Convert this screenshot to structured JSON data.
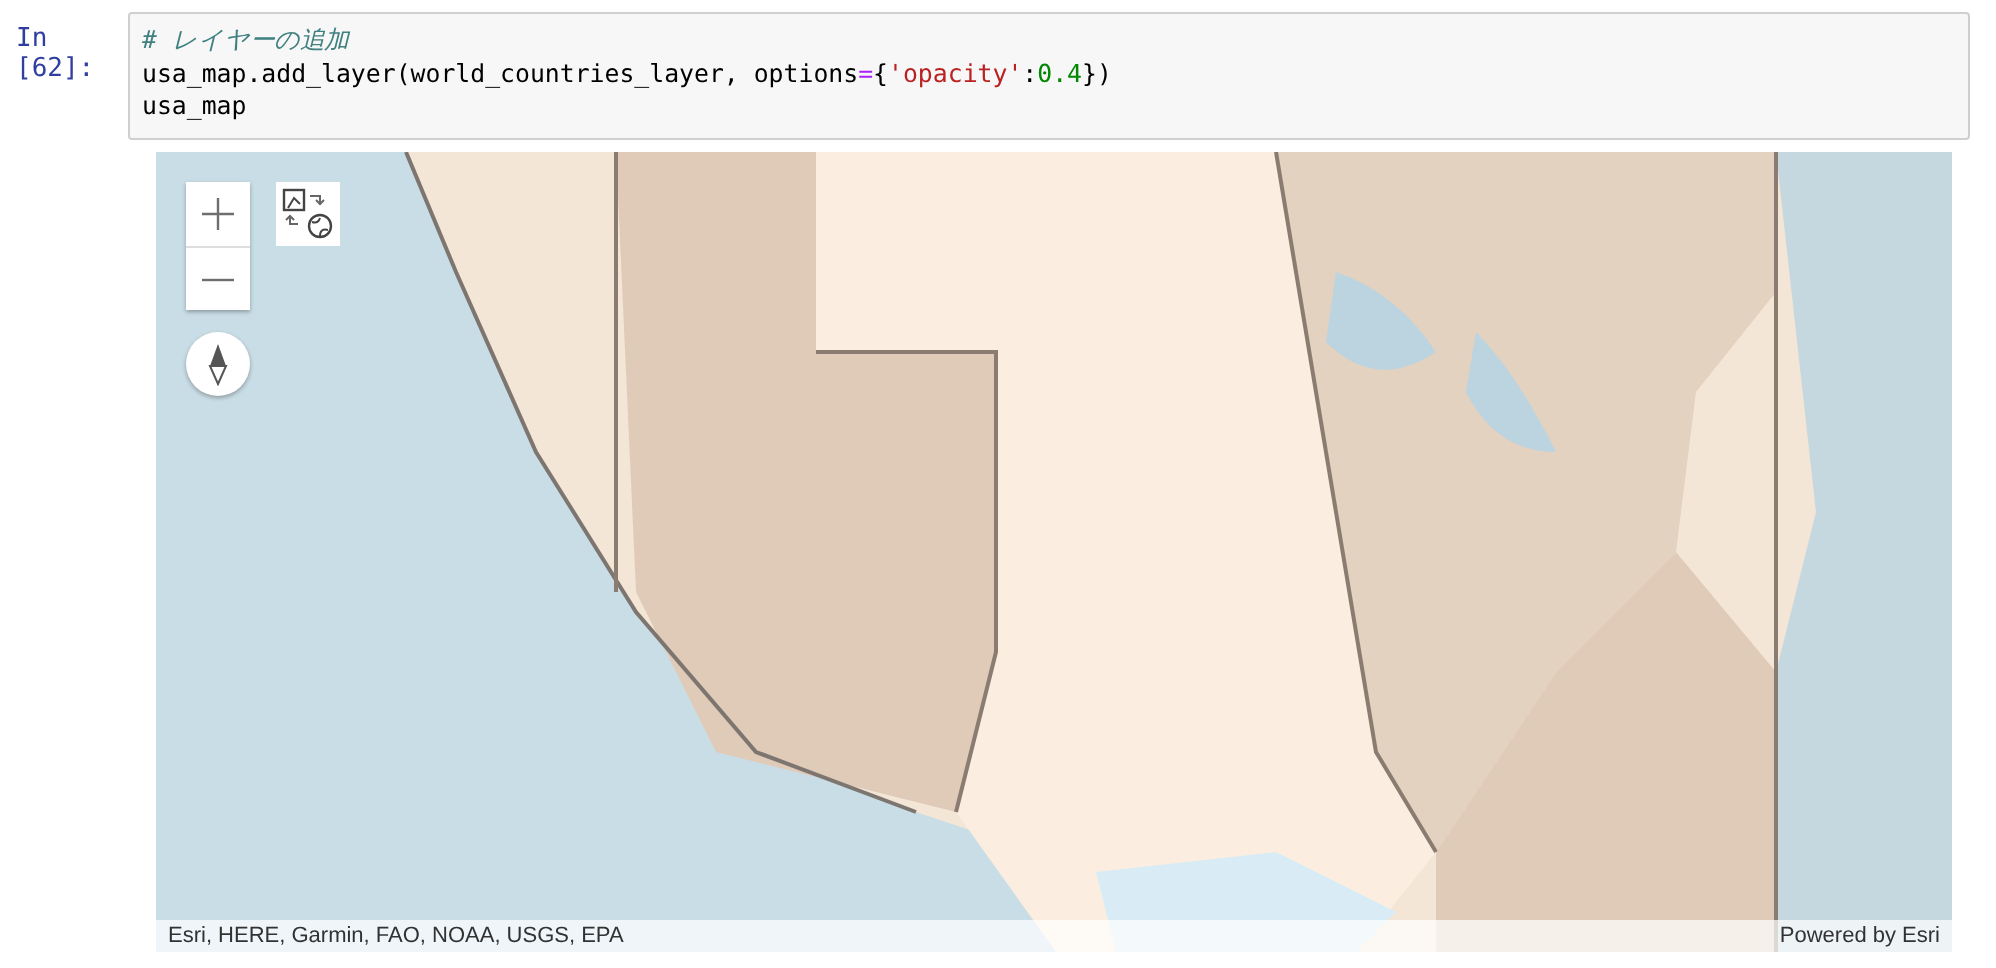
{
  "cell": {
    "prompt": "In [62]:",
    "lines": [
      [
        {
          "kind": "comment",
          "text": "# レイヤーの追加"
        }
      ],
      [
        {
          "kind": "plain",
          "text": "usa_map.add_layer(world_countries_layer, options"
        },
        {
          "kind": "operator",
          "text": "="
        },
        {
          "kind": "plain",
          "text": "{"
        },
        {
          "kind": "string",
          "text": "'opacity'"
        },
        {
          "kind": "plain",
          "text": ":"
        },
        {
          "kind": "number",
          "text": "0.4"
        },
        {
          "kind": "plain",
          "text": "})"
        }
      ],
      [
        {
          "kind": "plain",
          "text": "usa_map"
        }
      ]
    ]
  },
  "map": {
    "kind": "picture",
    "attribution": "Esri, HERE, Garmin, FAO, NOAA, USGS, EPA",
    "powered_by": "Powered by Esri"
  }
}
